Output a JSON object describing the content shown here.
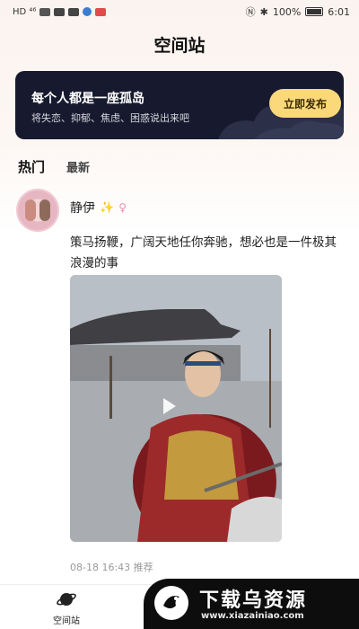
{
  "status_bar": {
    "left_text": "HD ⁴⁶",
    "battery_text": "100%",
    "time": "6:01"
  },
  "page": {
    "title": "空间站"
  },
  "banner": {
    "title": "每个人都是一座孤岛",
    "subtitle": "将失恋、抑郁、焦虑、困惑说出来吧",
    "button_label": "立即发布"
  },
  "tabs": {
    "hot": "热门",
    "latest": "最新"
  },
  "post": {
    "username": "静伊",
    "text": "策马扬鞭，广阔天地任你奔驰，想必也是一件极其浪漫的事",
    "meta": "08-18 16:43 推荐",
    "has_video": true
  },
  "bottom_nav": {
    "items": [
      {
        "label": "空间站",
        "icon": "planet-icon"
      }
    ]
  },
  "watermark": {
    "text": "下载乌资源",
    "url": "www.xiazainiao.com"
  },
  "colors": {
    "banner_bg": "#171a2e",
    "banner_button": "#fbd97a",
    "accent_sparkle": "#f4c32c"
  }
}
